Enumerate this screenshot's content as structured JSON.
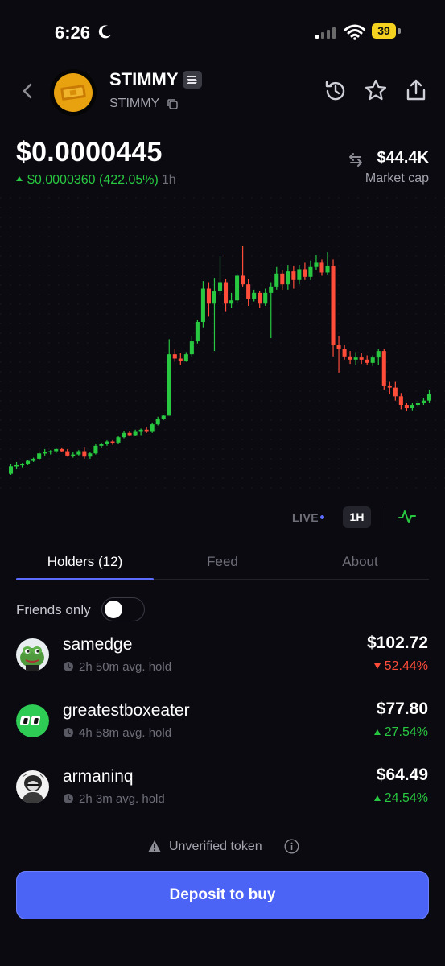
{
  "status_bar": {
    "time": "6:26",
    "battery": "39"
  },
  "token": {
    "name": "STIMMY",
    "ticker": "STIMMY",
    "price": "$0.0000445",
    "change_value": "$0.0000360",
    "change_pct": "(422.05%)",
    "change_period": "1h",
    "market_cap": "$44.4K",
    "market_cap_label": "Market cap"
  },
  "chart_controls": {
    "live_label": "LIVE",
    "timeframe": "1H",
    "chart_type_icon": "line-pulse-icon"
  },
  "chart_data": {
    "type": "candlestick",
    "title": "",
    "colors": {
      "up": "#28c840",
      "down": "#ff4d3a"
    },
    "grid": "dotted",
    "candles": [
      {
        "o": 0.4,
        "h": 1.3,
        "l": 0.3,
        "c": 1.1
      },
      {
        "o": 1.1,
        "h": 1.5,
        "l": 0.9,
        "c": 1.2
      },
      {
        "o": 1.2,
        "h": 1.4,
        "l": 1.0,
        "c": 1.3
      },
      {
        "o": 1.3,
        "h": 1.7,
        "l": 1.2,
        "c": 1.6
      },
      {
        "o": 1.6,
        "h": 1.9,
        "l": 1.5,
        "c": 1.8
      },
      {
        "o": 1.8,
        "h": 2.5,
        "l": 1.7,
        "c": 2.3
      },
      {
        "o": 2.3,
        "h": 2.7,
        "l": 2.1,
        "c": 2.4
      },
      {
        "o": 2.4,
        "h": 2.6,
        "l": 2.2,
        "c": 2.5
      },
      {
        "o": 2.5,
        "h": 2.8,
        "l": 2.3,
        "c": 2.7
      },
      {
        "o": 2.7,
        "h": 2.85,
        "l": 2.4,
        "c": 2.5
      },
      {
        "o": 2.5,
        "h": 2.7,
        "l": 2.0,
        "c": 2.1
      },
      {
        "o": 2.1,
        "h": 2.4,
        "l": 1.9,
        "c": 2.2
      },
      {
        "o": 2.2,
        "h": 2.6,
        "l": 2.1,
        "c": 2.5
      },
      {
        "o": 2.5,
        "h": 2.9,
        "l": 1.8,
        "c": 2.0
      },
      {
        "o": 2.0,
        "h": 2.4,
        "l": 1.8,
        "c": 2.3
      },
      {
        "o": 2.3,
        "h": 3.2,
        "l": 2.2,
        "c": 3.0
      },
      {
        "o": 3.0,
        "h": 3.3,
        "l": 2.8,
        "c": 3.2
      },
      {
        "o": 3.2,
        "h": 3.5,
        "l": 3.0,
        "c": 3.4
      },
      {
        "o": 3.4,
        "h": 3.6,
        "l": 3.1,
        "c": 3.3
      },
      {
        "o": 3.3,
        "h": 3.9,
        "l": 3.2,
        "c": 3.8
      },
      {
        "o": 3.8,
        "h": 4.4,
        "l": 3.7,
        "c": 4.2
      },
      {
        "o": 4.2,
        "h": 4.4,
        "l": 3.9,
        "c": 4.0
      },
      {
        "o": 4.0,
        "h": 4.5,
        "l": 3.9,
        "c": 4.3
      },
      {
        "o": 4.3,
        "h": 4.6,
        "l": 4.0,
        "c": 4.5
      },
      {
        "o": 4.5,
        "h": 4.7,
        "l": 4.2,
        "c": 4.3
      },
      {
        "o": 4.3,
        "h": 5.1,
        "l": 4.2,
        "c": 5.0
      },
      {
        "o": 5.0,
        "h": 5.7,
        "l": 4.9,
        "c": 5.5
      },
      {
        "o": 5.5,
        "h": 5.9,
        "l": 5.4,
        "c": 5.8
      },
      {
        "o": 5.8,
        "h": 12.9,
        "l": 5.8,
        "c": 11.5
      },
      {
        "o": 11.5,
        "h": 12.0,
        "l": 10.8,
        "c": 11.1
      },
      {
        "o": 11.1,
        "h": 11.6,
        "l": 10.5,
        "c": 10.9
      },
      {
        "o": 10.9,
        "h": 11.7,
        "l": 10.8,
        "c": 11.5
      },
      {
        "o": 11.5,
        "h": 13.2,
        "l": 11.3,
        "c": 12.7
      },
      {
        "o": 12.7,
        "h": 14.7,
        "l": 12.5,
        "c": 14.5
      },
      {
        "o": 14.5,
        "h": 18.3,
        "l": 14.0,
        "c": 17.6
      },
      {
        "o": 17.6,
        "h": 18.2,
        "l": 15.0,
        "c": 16.2
      },
      {
        "o": 16.2,
        "h": 18.6,
        "l": 11.8,
        "c": 17.4
      },
      {
        "o": 17.4,
        "h": 20.6,
        "l": 17.0,
        "c": 18.2
      },
      {
        "o": 18.2,
        "h": 18.5,
        "l": 15.5,
        "c": 16.2
      },
      {
        "o": 16.2,
        "h": 17.2,
        "l": 15.8,
        "c": 16.5
      },
      {
        "o": 16.5,
        "h": 19.0,
        "l": 16.2,
        "c": 18.8
      },
      {
        "o": 18.8,
        "h": 21.6,
        "l": 17.8,
        "c": 18.0
      },
      {
        "o": 18.0,
        "h": 18.5,
        "l": 16.0,
        "c": 16.6
      },
      {
        "o": 16.6,
        "h": 17.5,
        "l": 16.4,
        "c": 17.2
      },
      {
        "o": 17.2,
        "h": 17.4,
        "l": 15.8,
        "c": 16.2
      },
      {
        "o": 16.2,
        "h": 17.6,
        "l": 16.0,
        "c": 17.2
      },
      {
        "o": 17.2,
        "h": 18.2,
        "l": 13.0,
        "c": 17.8
      },
      {
        "o": 17.8,
        "h": 19.6,
        "l": 17.5,
        "c": 19.0
      },
      {
        "o": 19.0,
        "h": 19.3,
        "l": 17.5,
        "c": 18.0
      },
      {
        "o": 18.0,
        "h": 19.8,
        "l": 17.5,
        "c": 19.2
      },
      {
        "o": 19.2,
        "h": 19.7,
        "l": 17.6,
        "c": 18.4
      },
      {
        "o": 18.4,
        "h": 19.8,
        "l": 18.0,
        "c": 19.4
      },
      {
        "o": 19.4,
        "h": 20.0,
        "l": 18.4,
        "c": 18.7
      },
      {
        "o": 18.7,
        "h": 20.2,
        "l": 18.4,
        "c": 19.6
      },
      {
        "o": 19.6,
        "h": 20.7,
        "l": 19.3,
        "c": 20.0
      },
      {
        "o": 20.0,
        "h": 20.3,
        "l": 18.8,
        "c": 19.1
      },
      {
        "o": 19.1,
        "h": 21.0,
        "l": 18.9,
        "c": 19.7
      },
      {
        "o": 19.7,
        "h": 20.3,
        "l": 11.3,
        "c": 12.4
      },
      {
        "o": 12.4,
        "h": 13.2,
        "l": 9.8,
        "c": 12.0
      },
      {
        "o": 12.0,
        "h": 12.4,
        "l": 11.0,
        "c": 11.3
      },
      {
        "o": 11.3,
        "h": 11.8,
        "l": 10.6,
        "c": 11.0
      },
      {
        "o": 11.0,
        "h": 11.7,
        "l": 10.5,
        "c": 11.2
      },
      {
        "o": 11.2,
        "h": 11.6,
        "l": 10.6,
        "c": 11.0
      },
      {
        "o": 11.0,
        "h": 11.4,
        "l": 10.5,
        "c": 10.7
      },
      {
        "o": 10.7,
        "h": 11.4,
        "l": 10.4,
        "c": 11.2
      },
      {
        "o": 11.2,
        "h": 12.0,
        "l": 10.5,
        "c": 11.8
      },
      {
        "o": 11.8,
        "h": 12.0,
        "l": 8.2,
        "c": 8.6
      },
      {
        "o": 8.6,
        "h": 9.0,
        "l": 7.8,
        "c": 8.4
      },
      {
        "o": 8.4,
        "h": 9.0,
        "l": 7.2,
        "c": 7.6
      },
      {
        "o": 7.6,
        "h": 7.9,
        "l": 6.4,
        "c": 6.8
      },
      {
        "o": 6.8,
        "h": 7.0,
        "l": 6.2,
        "c": 6.5
      },
      {
        "o": 6.5,
        "h": 7.0,
        "l": 6.3,
        "c": 6.8
      },
      {
        "o": 6.8,
        "h": 7.2,
        "l": 6.6,
        "c": 7.0
      },
      {
        "o": 7.0,
        "h": 7.4,
        "l": 6.8,
        "c": 7.2
      },
      {
        "o": 7.2,
        "h": 8.2,
        "l": 7.0,
        "c": 7.8
      }
    ]
  },
  "tabs": [
    {
      "label": "Holders (12)",
      "active": true
    },
    {
      "label": "Feed",
      "active": false
    },
    {
      "label": "About",
      "active": false
    }
  ],
  "friends_only": {
    "label": "Friends only",
    "enabled": false
  },
  "holders": [
    {
      "name": "samedge",
      "hold": "2h 50m avg. hold",
      "value": "$102.72",
      "change": "52.44%",
      "direction": "down",
      "avatar": "frog-avatar"
    },
    {
      "name": "greatestboxeater",
      "hold": "4h 58m avg. hold",
      "value": "$77.80",
      "change": "27.54%",
      "direction": "up",
      "avatar": "green-eyes-avatar"
    },
    {
      "name": "armaninq",
      "hold": "2h 3m avg. hold",
      "value": "$64.49",
      "change": "24.54%",
      "direction": "up",
      "avatar": "sketch-avatar"
    }
  ],
  "footer": {
    "warning": "Unverified token",
    "deposit_label": "Deposit to buy"
  }
}
